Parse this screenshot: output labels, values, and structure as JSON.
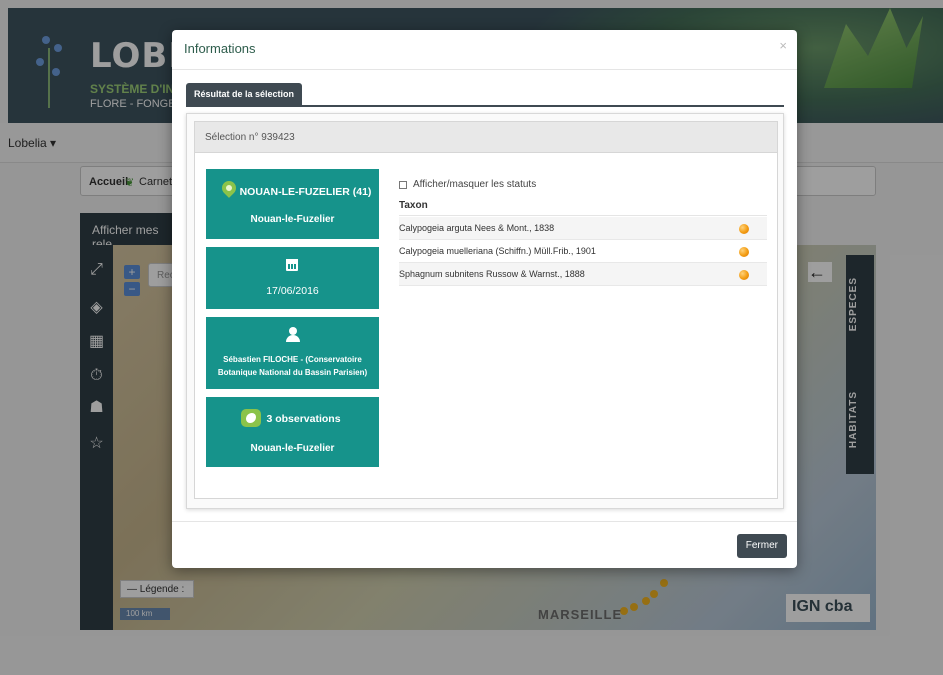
{
  "background": {
    "logo_title": "LOBELIA",
    "logo_subtitle": "SYSTÈME D'INFORMATION",
    "logo_tagline": "FLORE - FONGE - VÉGÉTATION",
    "nav_menu": "Lobelia ▾",
    "breadcrumb_home": "Accueil",
    "breadcrumb_item": "Carnet d",
    "display_button": "Afficher mes rele",
    "search_placeholder": "Rec",
    "legend_label": "— Légende :",
    "scale_label": "100 km",
    "map_city": "MARSEILLE",
    "side_tab_species": "ESPECES",
    "side_tab_habitats": "HABITATS",
    "attribution": "IGN cba"
  },
  "modal": {
    "title": "Informations",
    "close_glyph": "×",
    "tab_label": "Résultat de la sélection",
    "selection_heading": "Sélection n° 939423",
    "cards": {
      "location_title": "NOUAN-LE-FUZELIER (41)",
      "location_subtitle": "Nouan-le-Fuzelier",
      "date": "17/06/2016",
      "observer_line1": "Sébastien FILOCHE - (Conservatoire",
      "observer_line2": "Botanique National du Bassin Parisien)",
      "observations_count": "3 observations",
      "observations_place": "Nouan-le-Fuzelier"
    },
    "toggle_statuses_label": "Afficher/masquer les statuts",
    "table_header": "Taxon",
    "taxa": [
      "Calypogeia arguta Nees & Mont., 1838",
      "Calypogeia muelleriana (Schiffn.) Müll.Frib., 1901",
      "Sphagnum subnitens Russow & Warnst., 1888"
    ],
    "close_button": "Fermer"
  },
  "colors": {
    "card_teal": "#16938b",
    "dark_header": "#3f4a52",
    "status_orange": "#f39c12",
    "pin_green": "#8bc34a"
  }
}
